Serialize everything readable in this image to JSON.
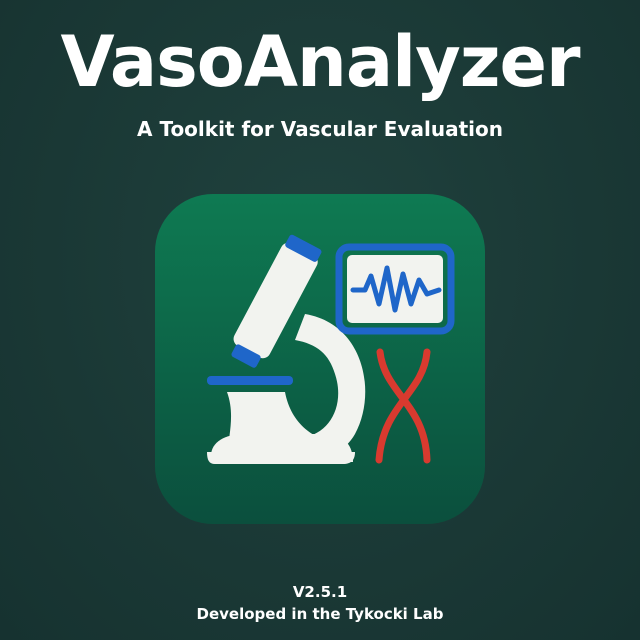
{
  "app": {
    "title": "VasoAnalyzer",
    "subtitle": "A Toolkit for Vascular Evaluation",
    "version": "V2.5.1",
    "credit": "Developed in the Tykocki Lab"
  },
  "icon": {
    "name": "microscope-waveform-vessel-icon",
    "colors": {
      "background_top": "#0e7a52",
      "background_bottom": "#0b4f3d",
      "microscope": "#f2f3ef",
      "accent_blue": "#1f66c9",
      "wave": "#1f66c9",
      "vessel_red": "#d93a2f"
    }
  },
  "colors": {
    "background": "#1a3835",
    "text": "#ffffff"
  }
}
